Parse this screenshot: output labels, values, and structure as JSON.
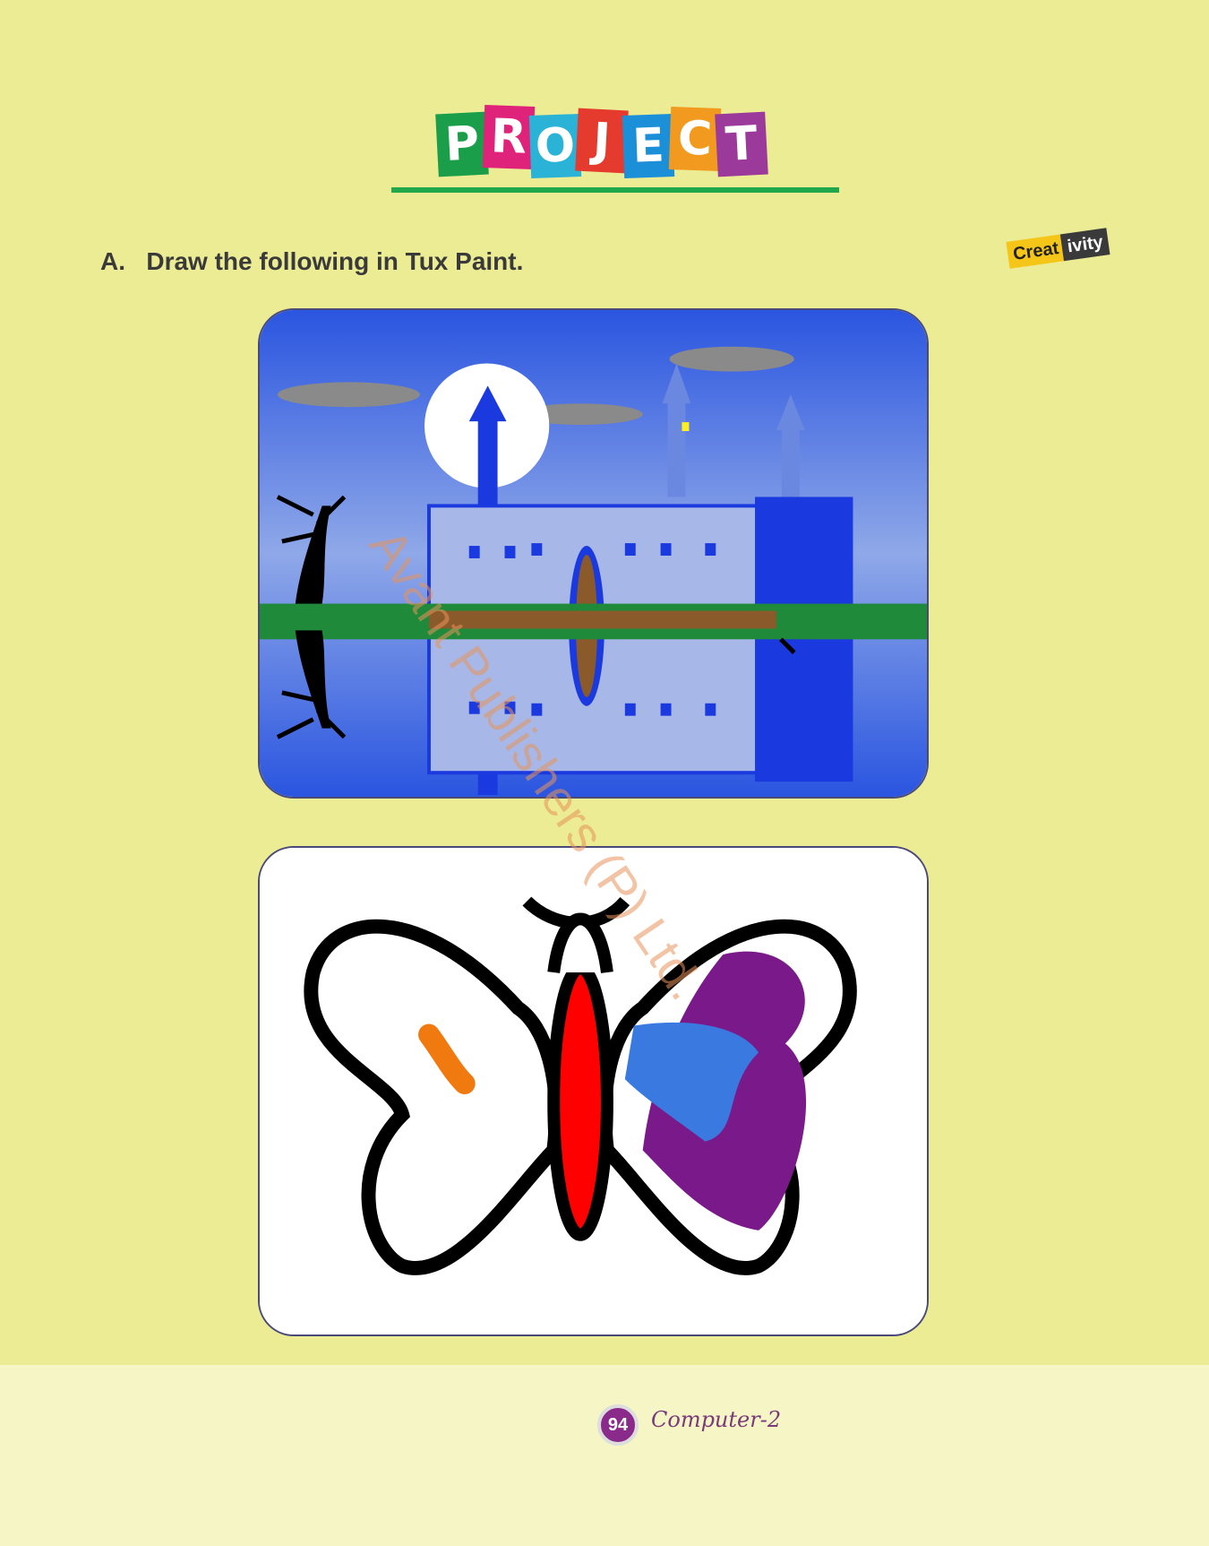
{
  "header": {
    "title_letters": [
      "P",
      "R",
      "O",
      "J",
      "E",
      "C",
      "T"
    ],
    "tile_colors": [
      "#1a9e4a",
      "#e0237a",
      "#2ab3d6",
      "#e53a2e",
      "#1b8fd8",
      "#f29a1f",
      "#9b3a9b"
    ]
  },
  "question": {
    "label": "A.",
    "text": "Draw the following in Tux Paint."
  },
  "badge": {
    "part_a": "Creat",
    "part_b": "ivity"
  },
  "images": {
    "castle": "castle-reflection-drawing",
    "butterfly": "butterfly-drawing"
  },
  "watermark": "Avant Publishers (P) Ltd.",
  "footer": {
    "page_number": "94",
    "book_name": "Computer-2"
  }
}
